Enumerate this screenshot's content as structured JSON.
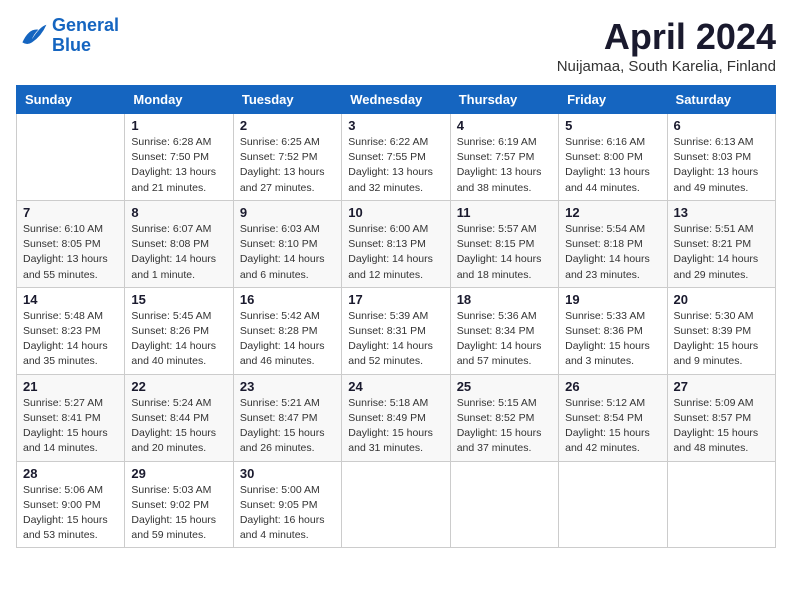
{
  "logo": {
    "line1": "General",
    "line2": "Blue"
  },
  "title": "April 2024",
  "subtitle": "Nuijamaa, South Karelia, Finland",
  "weekdays": [
    "Sunday",
    "Monday",
    "Tuesday",
    "Wednesday",
    "Thursday",
    "Friday",
    "Saturday"
  ],
  "weeks": [
    [
      {
        "day": "",
        "info": ""
      },
      {
        "day": "1",
        "info": "Sunrise: 6:28 AM\nSunset: 7:50 PM\nDaylight: 13 hours\nand 21 minutes."
      },
      {
        "day": "2",
        "info": "Sunrise: 6:25 AM\nSunset: 7:52 PM\nDaylight: 13 hours\nand 27 minutes."
      },
      {
        "day": "3",
        "info": "Sunrise: 6:22 AM\nSunset: 7:55 PM\nDaylight: 13 hours\nand 32 minutes."
      },
      {
        "day": "4",
        "info": "Sunrise: 6:19 AM\nSunset: 7:57 PM\nDaylight: 13 hours\nand 38 minutes."
      },
      {
        "day": "5",
        "info": "Sunrise: 6:16 AM\nSunset: 8:00 PM\nDaylight: 13 hours\nand 44 minutes."
      },
      {
        "day": "6",
        "info": "Sunrise: 6:13 AM\nSunset: 8:03 PM\nDaylight: 13 hours\nand 49 minutes."
      }
    ],
    [
      {
        "day": "7",
        "info": "Sunrise: 6:10 AM\nSunset: 8:05 PM\nDaylight: 13 hours\nand 55 minutes."
      },
      {
        "day": "8",
        "info": "Sunrise: 6:07 AM\nSunset: 8:08 PM\nDaylight: 14 hours\nand 1 minute."
      },
      {
        "day": "9",
        "info": "Sunrise: 6:03 AM\nSunset: 8:10 PM\nDaylight: 14 hours\nand 6 minutes."
      },
      {
        "day": "10",
        "info": "Sunrise: 6:00 AM\nSunset: 8:13 PM\nDaylight: 14 hours\nand 12 minutes."
      },
      {
        "day": "11",
        "info": "Sunrise: 5:57 AM\nSunset: 8:15 PM\nDaylight: 14 hours\nand 18 minutes."
      },
      {
        "day": "12",
        "info": "Sunrise: 5:54 AM\nSunset: 8:18 PM\nDaylight: 14 hours\nand 23 minutes."
      },
      {
        "day": "13",
        "info": "Sunrise: 5:51 AM\nSunset: 8:21 PM\nDaylight: 14 hours\nand 29 minutes."
      }
    ],
    [
      {
        "day": "14",
        "info": "Sunrise: 5:48 AM\nSunset: 8:23 PM\nDaylight: 14 hours\nand 35 minutes."
      },
      {
        "day": "15",
        "info": "Sunrise: 5:45 AM\nSunset: 8:26 PM\nDaylight: 14 hours\nand 40 minutes."
      },
      {
        "day": "16",
        "info": "Sunrise: 5:42 AM\nSunset: 8:28 PM\nDaylight: 14 hours\nand 46 minutes."
      },
      {
        "day": "17",
        "info": "Sunrise: 5:39 AM\nSunset: 8:31 PM\nDaylight: 14 hours\nand 52 minutes."
      },
      {
        "day": "18",
        "info": "Sunrise: 5:36 AM\nSunset: 8:34 PM\nDaylight: 14 hours\nand 57 minutes."
      },
      {
        "day": "19",
        "info": "Sunrise: 5:33 AM\nSunset: 8:36 PM\nDaylight: 15 hours\nand 3 minutes."
      },
      {
        "day": "20",
        "info": "Sunrise: 5:30 AM\nSunset: 8:39 PM\nDaylight: 15 hours\nand 9 minutes."
      }
    ],
    [
      {
        "day": "21",
        "info": "Sunrise: 5:27 AM\nSunset: 8:41 PM\nDaylight: 15 hours\nand 14 minutes."
      },
      {
        "day": "22",
        "info": "Sunrise: 5:24 AM\nSunset: 8:44 PM\nDaylight: 15 hours\nand 20 minutes."
      },
      {
        "day": "23",
        "info": "Sunrise: 5:21 AM\nSunset: 8:47 PM\nDaylight: 15 hours\nand 26 minutes."
      },
      {
        "day": "24",
        "info": "Sunrise: 5:18 AM\nSunset: 8:49 PM\nDaylight: 15 hours\nand 31 minutes."
      },
      {
        "day": "25",
        "info": "Sunrise: 5:15 AM\nSunset: 8:52 PM\nDaylight: 15 hours\nand 37 minutes."
      },
      {
        "day": "26",
        "info": "Sunrise: 5:12 AM\nSunset: 8:54 PM\nDaylight: 15 hours\nand 42 minutes."
      },
      {
        "day": "27",
        "info": "Sunrise: 5:09 AM\nSunset: 8:57 PM\nDaylight: 15 hours\nand 48 minutes."
      }
    ],
    [
      {
        "day": "28",
        "info": "Sunrise: 5:06 AM\nSunset: 9:00 PM\nDaylight: 15 hours\nand 53 minutes."
      },
      {
        "day": "29",
        "info": "Sunrise: 5:03 AM\nSunset: 9:02 PM\nDaylight: 15 hours\nand 59 minutes."
      },
      {
        "day": "30",
        "info": "Sunrise: 5:00 AM\nSunset: 9:05 PM\nDaylight: 16 hours\nand 4 minutes."
      },
      {
        "day": "",
        "info": ""
      },
      {
        "day": "",
        "info": ""
      },
      {
        "day": "",
        "info": ""
      },
      {
        "day": "",
        "info": ""
      }
    ]
  ]
}
